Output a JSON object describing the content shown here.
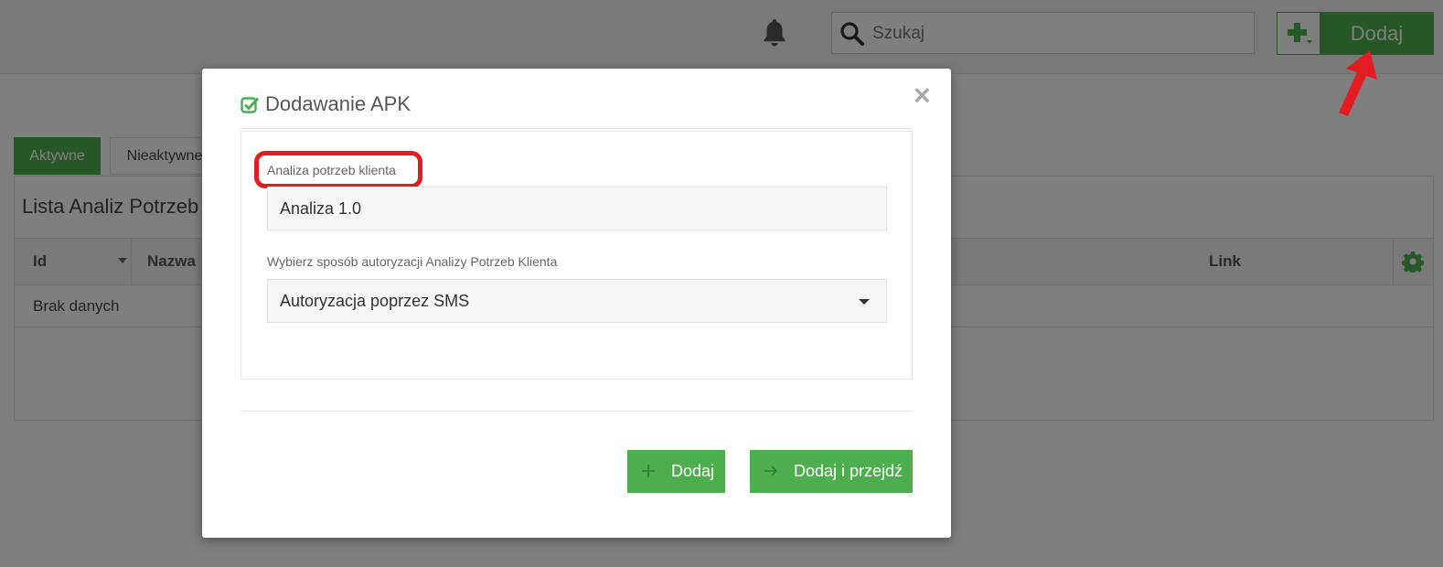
{
  "topbar": {
    "search": {
      "placeholder": "Szukaj",
      "value": ""
    },
    "add_button_label": "Dodaj"
  },
  "tabs": [
    {
      "label": "Aktywne",
      "active": true
    },
    {
      "label": "Nieaktywne",
      "active": false
    }
  ],
  "list": {
    "title": "Lista Analiz Potrzeb",
    "columns": [
      "Id",
      "Nazwa",
      "Link"
    ],
    "empty_text": "Brak danych"
  },
  "modal": {
    "title": "Dodawanie APK",
    "close_symbol": "×",
    "name_label": "Analiza potrzeb klienta",
    "name_value": "Analiza 1.0",
    "auth_label": "Wybierz sposób autoryzacji Analizy Potrzeb Klienta",
    "auth_value": "Autoryzacja poprzez SMS",
    "buttons": {
      "add": "Dodaj",
      "add_and_go": "Dodaj i przejdź"
    }
  },
  "colors": {
    "primary_green": "#4cae4c",
    "highlight_red": "#e31b23"
  },
  "icons": [
    "bell-icon",
    "search-icon",
    "plus-icon",
    "gear-icon",
    "check-square-icon",
    "close-icon",
    "caret-down-icon",
    "add-icon",
    "arrow-right-icon"
  ]
}
